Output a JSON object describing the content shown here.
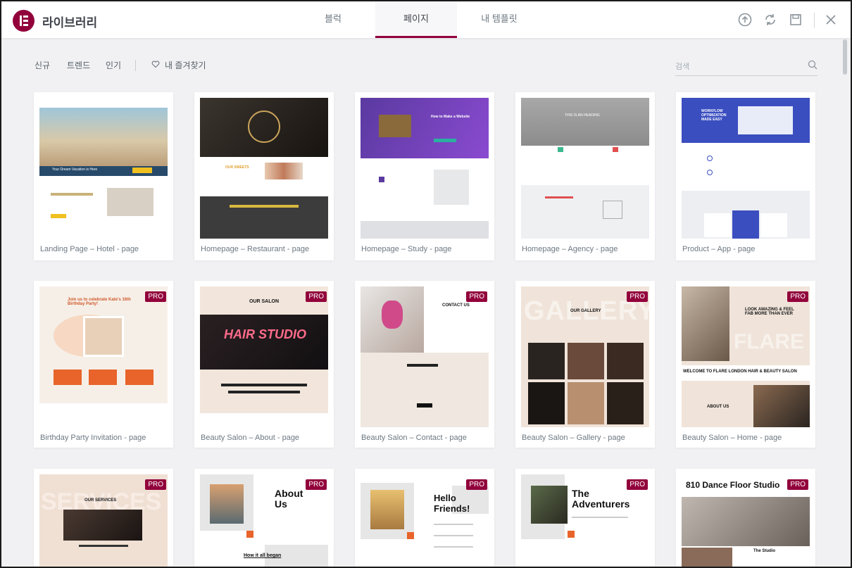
{
  "header": {
    "title": "라이브러리",
    "tabs": [
      {
        "label": "블럭",
        "active": false
      },
      {
        "label": "페이지",
        "active": true
      },
      {
        "label": "내 템플릿",
        "active": false
      }
    ],
    "icons": [
      "upload-icon",
      "sync-icon",
      "save-icon",
      "close-icon"
    ]
  },
  "filters": {
    "items": [
      "신규",
      "트렌드",
      "인기"
    ],
    "favorites_label": "내 즐겨찾기"
  },
  "search": {
    "placeholder": "검색"
  },
  "brand_color": "#92003b",
  "templates": [
    {
      "label": "Landing Page – Hotel - page",
      "pro": false,
      "thumb_text": "Your Dream Vacation is Here"
    },
    {
      "label": "Homepage – Restaurant - page",
      "pro": false,
      "thumb_text": "OUR SWEETS"
    },
    {
      "label": "Homepage – Study - page",
      "pro": false,
      "thumb_text": "How to Make a Website"
    },
    {
      "label": "Homepage – Agency - page",
      "pro": false,
      "thumb_text": "THIS IS AN HEADING"
    },
    {
      "label": "Product – App - page",
      "pro": false,
      "thumb_text": "WORKFLOW OPTIMIZATION MADE EASY"
    },
    {
      "label": "Birthday Party Invitation - page",
      "pro": true,
      "thumb_text": "Join us to celebrate Kate's 16th Birthday Party!"
    },
    {
      "label": "Beauty Salon – About - page",
      "pro": true,
      "thumb_text": "OUR SALON"
    },
    {
      "label": "Beauty Salon – Contact - page",
      "pro": true,
      "thumb_text": "CONTACT US"
    },
    {
      "label": "Beauty Salon – Gallery - page",
      "pro": true,
      "thumb_text": "OUR GALLERY"
    },
    {
      "label": "Beauty Salon – Home - page",
      "pro": true,
      "thumb_text": "LOOK AMAZING & FEEL FAB MORE THAN EVER"
    },
    {
      "label": "",
      "pro": true,
      "thumb_text": "OUR SERVICES"
    },
    {
      "label": "",
      "pro": true,
      "thumb_text": "About Us"
    },
    {
      "label": "",
      "pro": true,
      "thumb_text": "Hello Friends!"
    },
    {
      "label": "",
      "pro": true,
      "thumb_text": "The Adventurers"
    },
    {
      "label": "",
      "pro": true,
      "thumb_text": "810 Dance Floor Studio"
    }
  ],
  "pro_badge": "PRO"
}
